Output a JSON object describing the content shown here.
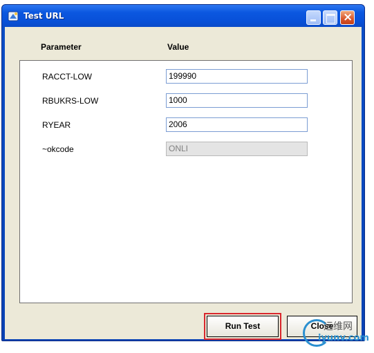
{
  "window": {
    "title": "Test URL"
  },
  "columns": {
    "parameter": "Parameter",
    "value": "Value"
  },
  "rows": [
    {
      "label": "RACCT-LOW",
      "value": "199990",
      "disabled": false
    },
    {
      "label": "RBUKRS-LOW",
      "value": "1000",
      "disabled": false
    },
    {
      "label": "RYEAR",
      "value": "2006",
      "disabled": false
    },
    {
      "label": "~okcode",
      "value": "ONLI",
      "disabled": true
    }
  ],
  "buttons": {
    "run_test": "Run Test",
    "close": "Close"
  },
  "watermark": {
    "cn": "运维网",
    "en": "iyunv.com"
  },
  "colors": {
    "titlebar": "#0b57e0",
    "client_bg": "#ece9d8",
    "highlight": "#d9262c"
  }
}
